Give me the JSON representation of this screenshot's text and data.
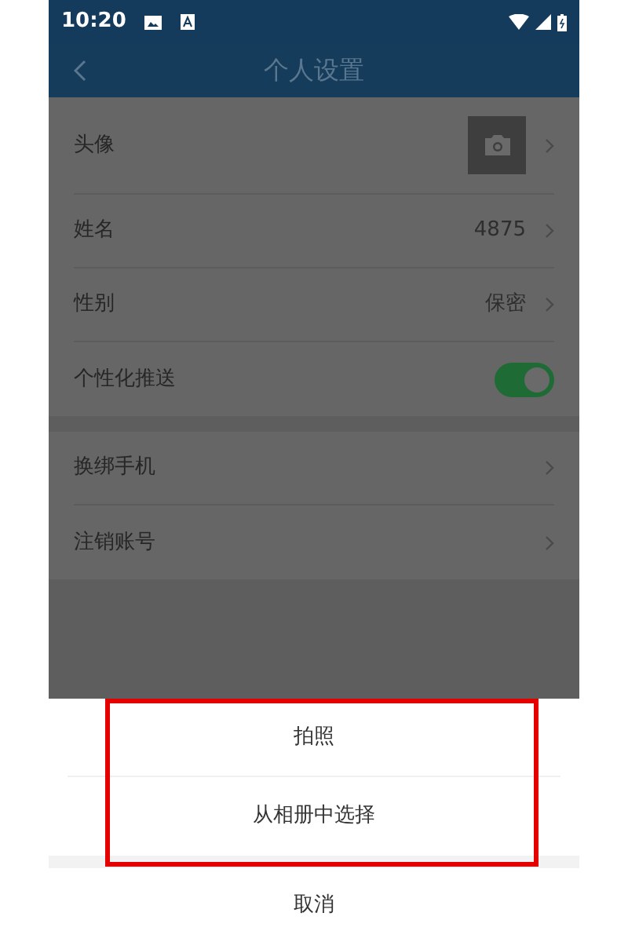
{
  "status_bar": {
    "time": "10:20"
  },
  "header": {
    "title": "个人设置"
  },
  "groups": [
    {
      "items": [
        {
          "kind": "avatar",
          "label": "头像"
        },
        {
          "kind": "value",
          "label": "姓名",
          "value": "4875"
        },
        {
          "kind": "value",
          "label": "性别",
          "value": "保密"
        },
        {
          "kind": "toggle",
          "label": "个性化推送",
          "on": true
        }
      ]
    },
    {
      "items": [
        {
          "kind": "link",
          "label": "换绑手机"
        },
        {
          "kind": "link",
          "label": "注销账号"
        }
      ]
    }
  ],
  "action_sheet": {
    "options": [
      "拍照",
      "从相册中选择"
    ],
    "cancel": "取消",
    "highlight_frame": true
  }
}
